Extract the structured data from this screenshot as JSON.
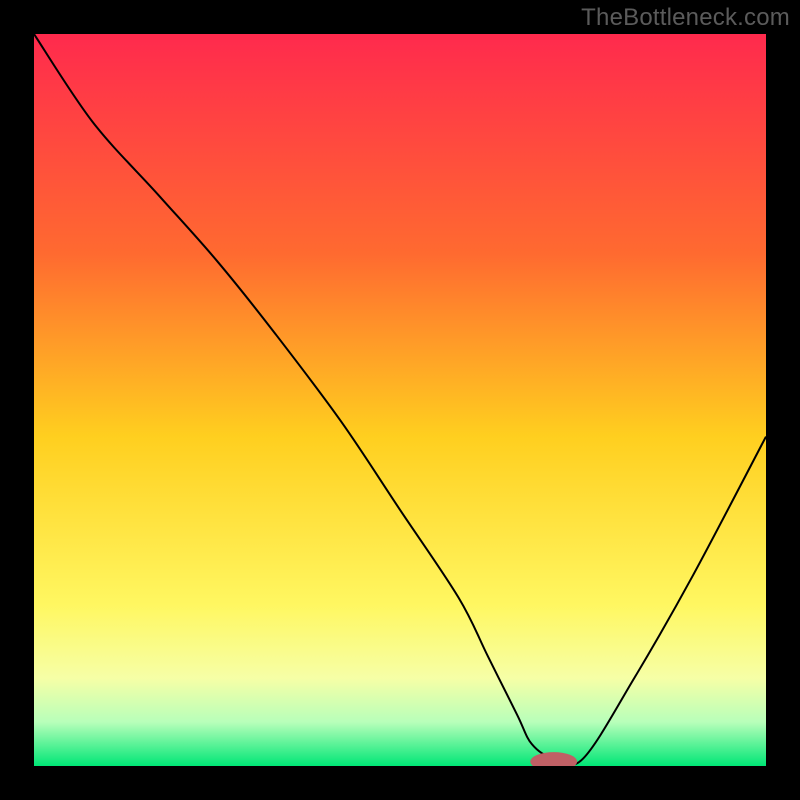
{
  "watermark": "TheBottleneck.com",
  "chart_data": {
    "type": "line",
    "title": "",
    "xlabel": "",
    "ylabel": "",
    "xlim": [
      0,
      100
    ],
    "ylim": [
      0,
      100
    ],
    "grid": false,
    "legend": false,
    "background_gradient": {
      "stops": [
        {
          "offset": 0.0,
          "color": "#ff2a4d"
        },
        {
          "offset": 0.3,
          "color": "#ff6a30"
        },
        {
          "offset": 0.55,
          "color": "#ffcf1f"
        },
        {
          "offset": 0.78,
          "color": "#fff761"
        },
        {
          "offset": 0.88,
          "color": "#f6ffa6"
        },
        {
          "offset": 0.94,
          "color": "#b8ffba"
        },
        {
          "offset": 1.0,
          "color": "#00e676"
        }
      ]
    },
    "series": [
      {
        "name": "bottleneck-curve",
        "color": "#000000",
        "x": [
          0,
          8,
          17,
          25,
          33,
          42,
          50,
          58,
          62,
          66,
          68,
          71,
          75,
          82,
          90,
          100
        ],
        "y": [
          100,
          88,
          78,
          69,
          59,
          47,
          35,
          23,
          15,
          7,
          3,
          1,
          1,
          12,
          26,
          45
        ]
      }
    ],
    "marker": {
      "name": "optimal-point",
      "cx": 71,
      "cy": 0.6,
      "rx": 3.2,
      "ry": 1.3,
      "fill": "#c06065"
    }
  }
}
